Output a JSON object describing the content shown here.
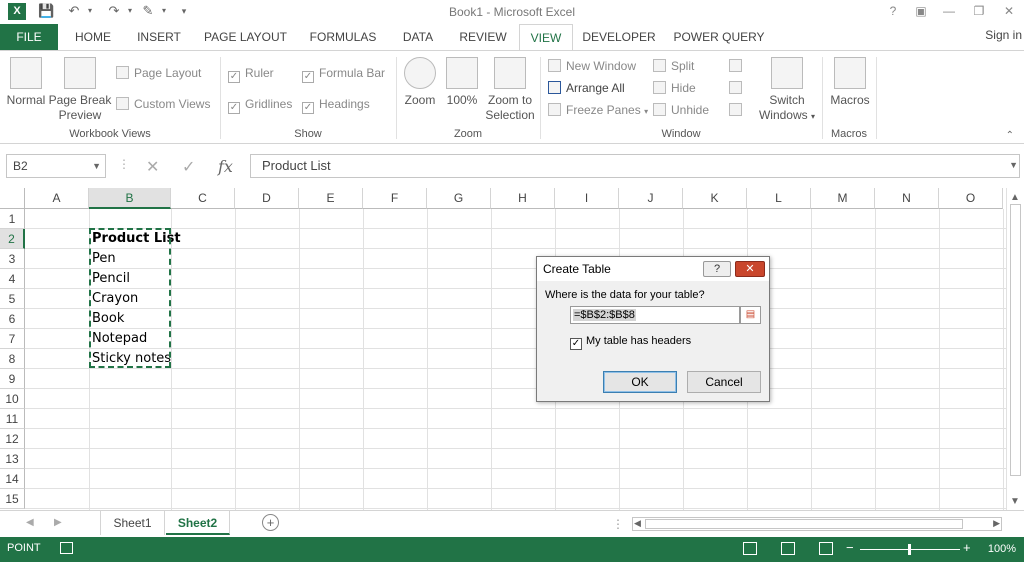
{
  "window": {
    "title": "Book1 - Microsoft Excel"
  },
  "ribbon_tabs": [
    "FILE",
    "HOME",
    "INSERT",
    "PAGE LAYOUT",
    "FORMULAS",
    "DATA",
    "REVIEW",
    "VIEW",
    "DEVELOPER",
    "POWER QUERY"
  ],
  "active_tab": "VIEW",
  "signin": "Sign in",
  "ribbon": {
    "workbook_views": {
      "label": "Workbook Views",
      "normal": "Normal",
      "page_break_1": "Page Break",
      "page_break_2": "Preview",
      "page_layout": "Page Layout",
      "custom_views": "Custom Views"
    },
    "show": {
      "label": "Show",
      "ruler": "Ruler",
      "formula_bar": "Formula Bar",
      "gridlines": "Gridlines",
      "headings": "Headings"
    },
    "zoom": {
      "label": "Zoom",
      "zoom": "Zoom",
      "hundred": "100%",
      "zoom_sel_1": "Zoom to",
      "zoom_sel_2": "Selection"
    },
    "window": {
      "label": "Window",
      "new_window": "New Window",
      "arrange_all": "Arrange All",
      "freeze_panes": "Freeze Panes",
      "split": "Split",
      "hide": "Hide",
      "unhide": "Unhide",
      "switch_1": "Switch",
      "switch_2": "Windows"
    },
    "macros": {
      "label": "Macros",
      "macros": "Macros"
    }
  },
  "formula_bar": {
    "name_box": "B2",
    "content": "Product List"
  },
  "columns": [
    "A",
    "B",
    "C",
    "D",
    "E",
    "F",
    "G",
    "H",
    "I",
    "J",
    "K",
    "L",
    "M",
    "N",
    "O"
  ],
  "selected_column": "B",
  "rows": [
    "1",
    "2",
    "3",
    "4",
    "5",
    "6",
    "7",
    "8",
    "9",
    "10",
    "11",
    "12",
    "13",
    "14",
    "15"
  ],
  "selected_row": "2",
  "cells_b": [
    {
      "row": "2",
      "value": "Product List",
      "bold": true
    },
    {
      "row": "3",
      "value": "Pen"
    },
    {
      "row": "4",
      "value": "Pencil"
    },
    {
      "row": "5",
      "value": "Crayon"
    },
    {
      "row": "6",
      "value": "Book"
    },
    {
      "row": "7",
      "value": "Notepad"
    },
    {
      "row": "8",
      "value": "Sticky notes"
    }
  ],
  "sheets": [
    "Sheet1",
    "Sheet2"
  ],
  "active_sheet": "Sheet2",
  "status": {
    "mode": "POINT",
    "zoom": "100%"
  },
  "dialog": {
    "title": "Create Table",
    "help": "?",
    "prompt": "Where is the data for your table?",
    "range": "=$B$2:$B$8",
    "has_headers_label": "My table has headers",
    "has_headers": true,
    "ok": "OK",
    "cancel": "Cancel"
  },
  "colors": {
    "excel_green": "#217346",
    "close_red": "#c9462c"
  }
}
